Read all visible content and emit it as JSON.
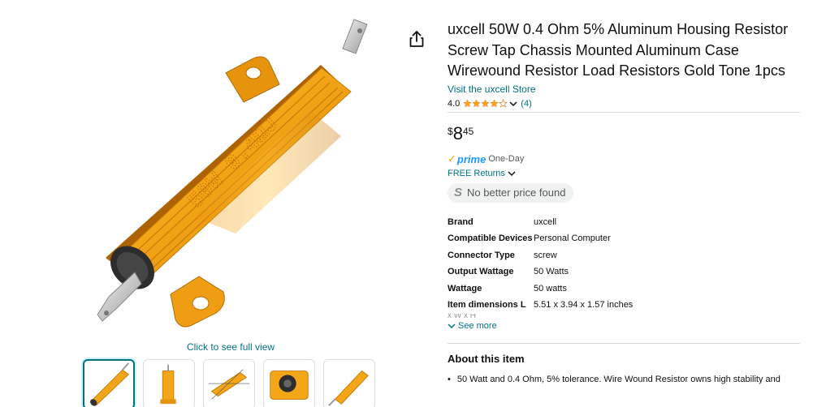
{
  "product": {
    "title": "uxcell 50W 0.4 Ohm 5% Aluminum Housing Resistor Screw Tap Chassis Mounted Aluminum Case Wirewound Resistor Load Resistors Gold Tone 1pcs",
    "store_link": "Visit the uxcell Store",
    "rating": "4.0",
    "rating_stars": 4.0,
    "review_count": "(4)",
    "price": {
      "symbol": "$",
      "whole": "8",
      "fraction": "45"
    },
    "prime_check": "✓",
    "prime_word": "prime",
    "prime_delivery": "One-Day",
    "returns": "FREE Returns",
    "badge_letter": "S",
    "badge_text": "No better price found"
  },
  "image": {
    "resistor_marking": "50W 0.4ΩJ",
    "full_view_link": "Click to see full view",
    "thumbnail_count": 5,
    "selected_thumbnail": 1
  },
  "specs": [
    {
      "key": "Brand",
      "value": "uxcell"
    },
    {
      "key": "Compatible Devices",
      "value": "Personal Computer"
    },
    {
      "key": "Connector Type",
      "value": "screw"
    },
    {
      "key": "Output Wattage",
      "value": "50 Watts"
    },
    {
      "key": "Wattage",
      "value": "50 watts"
    },
    {
      "key": "Item dimensions L",
      "value": "5.51 x 3.94 x 1.57 inches"
    }
  ],
  "spec_fade_text": "x W x H",
  "see_more": "See more",
  "about": {
    "title": "About this item",
    "bullets": [
      "50 Watt and 0.4 Ohm, 5% tolerance. Wire Wound Resistor owns high stability and"
    ]
  },
  "colors": {
    "link": "#007185",
    "star": "#ffa41c",
    "prime_blue": "#1a98ff",
    "prime_check": "#ff9900",
    "resistor_gold": "#f2a516"
  },
  "icons": {
    "share": "share-icon",
    "chevron": "chevron-down-icon",
    "star": "star-icon"
  }
}
